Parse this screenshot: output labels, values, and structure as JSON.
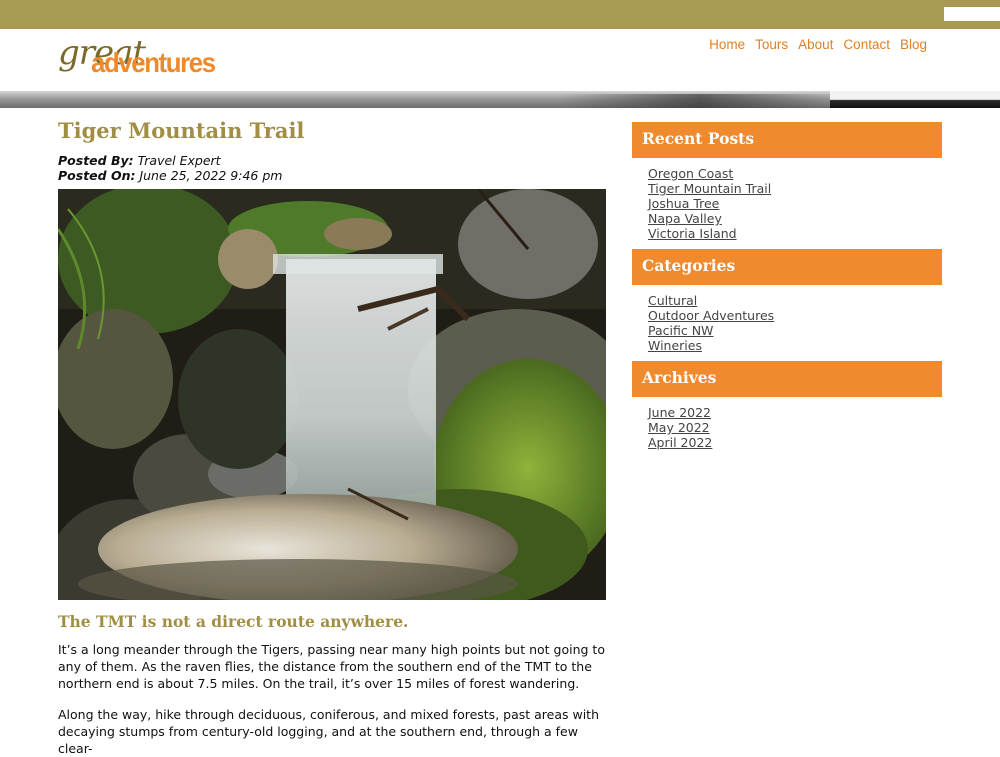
{
  "site": {
    "logo_top": "great",
    "logo_bottom": "adventures",
    "nav": [
      "Home",
      "Tours",
      "About",
      "Contact",
      "Blog"
    ]
  },
  "post": {
    "title": "Tiger Mountain Trail",
    "posted_by_label": "Posted By:",
    "posted_by": "Travel Expert",
    "posted_on_label": "Posted On:",
    "posted_on": "June 25, 2022 9:46 pm",
    "image_subject": "mossy-waterfall-photo",
    "subheading": "The TMT is not a direct route anywhere.",
    "paragraph1": "It’s a long meander through the Tigers, passing near many high points but not going to any of them. As the raven flies, the distance from the southern end of the TMT to the northern end is about 7.5 miles. On the trail, it’s over 15 miles of forest wandering.",
    "paragraph2": "Along the way, hike through deciduous, coniferous, and mixed forests, past areas with decaying stumps from century-old logging, and at the southern end, through a few clear-"
  },
  "sidebar": {
    "recent_title": "Recent Posts",
    "recent": [
      "Oregon Coast",
      "Tiger Mountain Trail",
      "Joshua Tree",
      "Napa Valley",
      "Victoria Island"
    ],
    "categories_title": "Categories",
    "categories": [
      "Cultural",
      "Outdoor Adventures",
      "Pacific NW",
      "Wineries"
    ],
    "archives_title": "Archives",
    "archives": [
      "June 2022",
      "May 2022",
      "April 2022"
    ]
  },
  "colors": {
    "topbar": "#a89a52",
    "accent_orange": "#f08a2e",
    "heading_gold": "#a08e45"
  }
}
